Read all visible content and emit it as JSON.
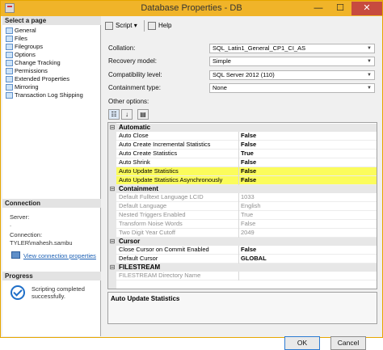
{
  "window": {
    "title": "Database Properties - DB",
    "minimize": "—",
    "maximize": "☐",
    "close": "✕"
  },
  "left": {
    "select_page_header": "Select a page",
    "pages": [
      "General",
      "Files",
      "Filegroups",
      "Options",
      "Change Tracking",
      "Permissions",
      "Extended Properties",
      "Mirroring",
      "Transaction Log Shipping"
    ],
    "connection_header": "Connection",
    "server_label": "Server:",
    "server_value": ".",
    "connection_label": "Connection:",
    "connection_value": "TYLER\\mahesh.sambu",
    "view_connection_link": "View connection properties",
    "progress_header": "Progress",
    "progress_text": "Scripting completed successfully."
  },
  "toolbar": {
    "script_label": "Script",
    "script_arrow": "▾",
    "help_label": "Help"
  },
  "form": {
    "collation_label": "Collation:",
    "collation_value": "SQL_Latin1_General_CP1_CI_AS",
    "recovery_label": "Recovery model:",
    "recovery_value": "Simple",
    "compat_label": "Compatibility level:",
    "compat_value": "SQL Server 2012 (110)",
    "containment_label": "Containment type:",
    "containment_value": "None",
    "other_options_label": "Other options:",
    "dropdown_arrow": "▼"
  },
  "grid": {
    "categories": [
      {
        "label": "Automatic",
        "toggle": "⊟"
      },
      {
        "label": "Containment",
        "toggle": "⊟"
      },
      {
        "label": "Cursor",
        "toggle": "⊟"
      },
      {
        "label": "FILESTREAM",
        "toggle": "⊟"
      }
    ],
    "rows": [
      {
        "name": "Auto Close",
        "value": "False"
      },
      {
        "name": "Auto Create Incremental Statistics",
        "value": "False"
      },
      {
        "name": "Auto Create Statistics",
        "value": "True"
      },
      {
        "name": "Auto Shrink",
        "value": "False"
      },
      {
        "name": "Auto Update Statistics",
        "value": "False"
      },
      {
        "name": "Auto Update Statistics Asynchronously",
        "value": "False"
      },
      {
        "name": "Default Fulltext Language LCID",
        "value": "1033"
      },
      {
        "name": "Default Language",
        "value": "English"
      },
      {
        "name": "Nested Triggers Enabled",
        "value": "True"
      },
      {
        "name": "Transform Noise Words",
        "value": "False"
      },
      {
        "name": "Two Digit Year Cutoff",
        "value": "2049"
      },
      {
        "name": "Close Cursor on Commit Enabled",
        "value": "False"
      },
      {
        "name": "Default Cursor",
        "value": "GLOBAL"
      },
      {
        "name": "FILESTREAM Directory Name",
        "value": ""
      }
    ],
    "highlight_color": "#fbfc5c"
  },
  "description": {
    "title": "Auto Update Statistics"
  },
  "buttons": {
    "ok": "OK",
    "cancel": "Cancel"
  }
}
